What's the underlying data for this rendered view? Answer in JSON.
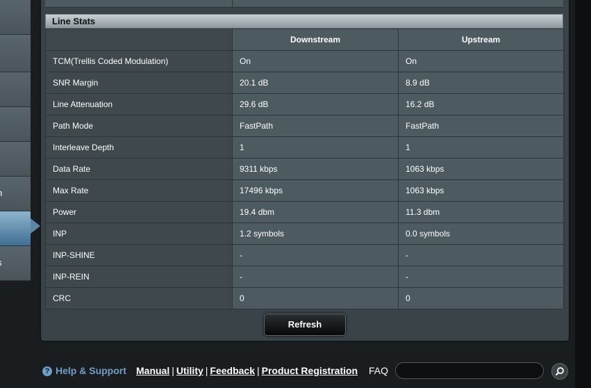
{
  "sidebar": {
    "items": [
      {
        "label": ""
      },
      {
        "label": ""
      },
      {
        "label": ""
      },
      {
        "label": ""
      },
      {
        "label": ""
      },
      {
        "label": "n"
      },
      {
        "label": ""
      },
      {
        "label": "s"
      }
    ]
  },
  "line_stats": {
    "title": "Line Stats",
    "columns": [
      "",
      "Downstream",
      "Upstream"
    ],
    "rows": [
      {
        "label": "TCM(Trellis Coded Modulation)",
        "downstream": "On",
        "upstream": "On"
      },
      {
        "label": "SNR Margin",
        "downstream": "20.1 dB",
        "upstream": "8.9 dB"
      },
      {
        "label": "Line Attenuation",
        "downstream": "29.6 dB",
        "upstream": "16.2 dB"
      },
      {
        "label": "Path Mode",
        "downstream": "FastPath",
        "upstream": "FastPath"
      },
      {
        "label": "Interleave Depth",
        "downstream": "1",
        "upstream": "1"
      },
      {
        "label": "Data Rate",
        "downstream": "9311 kbps",
        "upstream": "1063 kbps"
      },
      {
        "label": "Max Rate",
        "downstream": "17496 kbps",
        "upstream": "1063 kbps"
      },
      {
        "label": "Power",
        "downstream": "19.4 dbm",
        "upstream": "11.3 dbm"
      },
      {
        "label": "INP",
        "downstream": "1.2 symbols",
        "upstream": "0.0 symbols"
      },
      {
        "label": "INP-SHINE",
        "downstream": "-",
        "upstream": "-"
      },
      {
        "label": "INP-REIN",
        "downstream": "-",
        "upstream": "-"
      },
      {
        "label": "CRC",
        "downstream": "0",
        "upstream": "0"
      }
    ],
    "refresh_label": "Refresh"
  },
  "footer": {
    "help_label": "Help & Support",
    "links": [
      "Manual",
      "Utility",
      "Feedback",
      "Product Registration"
    ],
    "faq_label": "FAQ",
    "faq_value": "",
    "icons": {
      "help": "question-icon",
      "search": "search-icon"
    }
  },
  "colors": {
    "accent": "#6f9fc8",
    "panel": "#3a4347",
    "cell": "#4d5a60",
    "header_bar": "#c9d0d4"
  }
}
